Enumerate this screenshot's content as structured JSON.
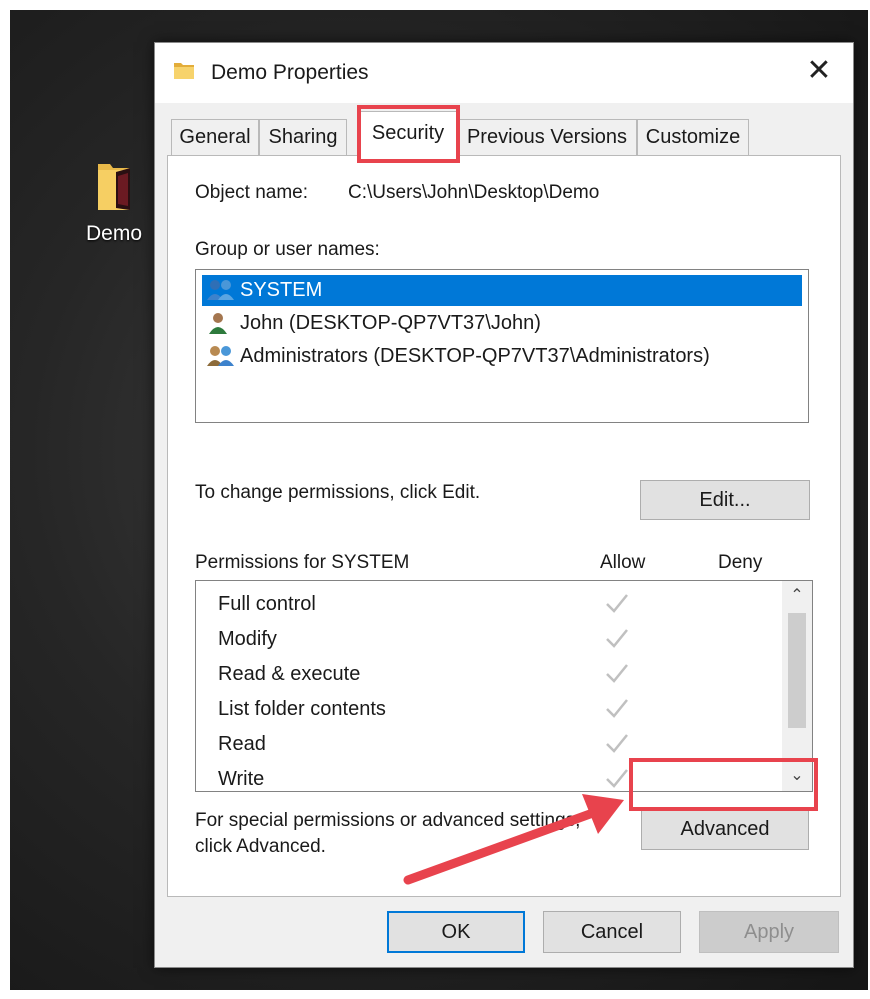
{
  "desktop": {
    "icon_label": "Demo"
  },
  "dialog": {
    "title": "Demo Properties",
    "close_glyph": "✕",
    "tabs": [
      {
        "label": "General"
      },
      {
        "label": "Sharing"
      },
      {
        "label": "Security",
        "selected": true
      },
      {
        "label": "Previous Versions"
      },
      {
        "label": "Customize"
      }
    ]
  },
  "security": {
    "object_name_label": "Object name:",
    "object_name_value": "C:\\Users\\John\\Desktop\\Demo",
    "group_label": "Group or user names:",
    "users": [
      {
        "name": "SYSTEM",
        "icon": "group-users-icon",
        "selected": true
      },
      {
        "name": "John (DESKTOP-QP7VT37\\John)",
        "icon": "user-icon"
      },
      {
        "name": "Administrators (DESKTOP-QP7VT37\\Administrators)",
        "icon": "admin-group-icon"
      }
    ],
    "change_text": "To change permissions, click Edit.",
    "edit_label": "Edit...",
    "permissions_header": "Permissions for SYSTEM",
    "allow_header": "Allow",
    "deny_header": "Deny",
    "permissions": [
      {
        "name": "Full control",
        "allow": true,
        "deny": false
      },
      {
        "name": "Modify",
        "allow": true,
        "deny": false
      },
      {
        "name": "Read & execute",
        "allow": true,
        "deny": false
      },
      {
        "name": "List folder contents",
        "allow": true,
        "deny": false
      },
      {
        "name": "Read",
        "allow": true,
        "deny": false
      },
      {
        "name": "Write",
        "allow": true,
        "deny": false
      }
    ],
    "special_line1": "For special permissions or advanced settings,",
    "special_line2": "click Advanced.",
    "advanced_label": "Advanced"
  },
  "footer": {
    "ok_label": "OK",
    "cancel_label": "Cancel",
    "apply_label": "Apply"
  },
  "colors": {
    "selection": "#0078d7",
    "annotation": "#e8434d",
    "check_disabled": "#c0c0c0"
  }
}
